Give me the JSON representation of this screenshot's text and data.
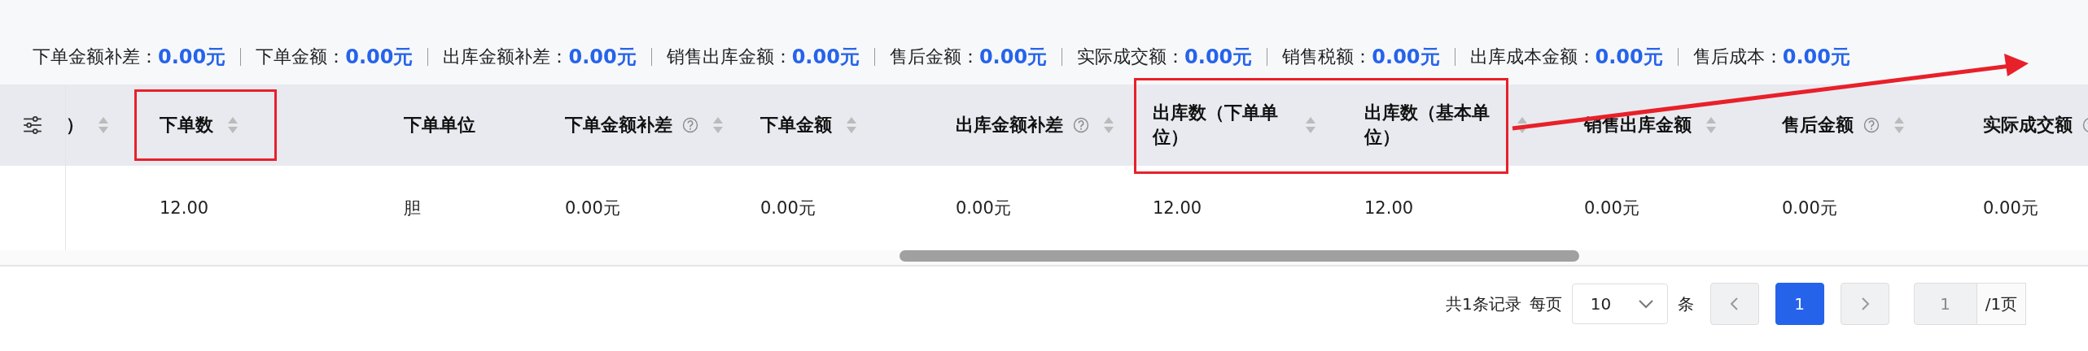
{
  "summary": [
    {
      "label": "下单金额补差：",
      "value": "0.00元"
    },
    {
      "label": "下单金额：",
      "value": "0.00元"
    },
    {
      "label": "出库金额补差：",
      "value": "0.00元"
    },
    {
      "label": "销售出库金额：",
      "value": "0.00元"
    },
    {
      "label": "售后金额：",
      "value": "0.00元"
    },
    {
      "label": "实际成交额：",
      "value": "0.00元"
    },
    {
      "label": "销售税额：",
      "value": "0.00元"
    },
    {
      "label": "出库成本金额：",
      "value": "0.00元"
    },
    {
      "label": "售后成本：",
      "value": "0.00元"
    }
  ],
  "table": {
    "columns": [
      {
        "title": "）",
        "sortable": true,
        "help": false
      },
      {
        "title": "下单数",
        "sortable": true,
        "help": false
      },
      {
        "title": "下单单位",
        "sortable": false,
        "help": false
      },
      {
        "title": "下单金额补差",
        "sortable": true,
        "help": true
      },
      {
        "title": "下单金额",
        "sortable": true,
        "help": false
      },
      {
        "title": "出库金额补差",
        "sortable": true,
        "help": true
      },
      {
        "title": "出库数（下单单位）",
        "sortable": true,
        "help": false
      },
      {
        "title": "出库数（基本单位）",
        "sortable": true,
        "help": false
      },
      {
        "title": "销售出库金额",
        "sortable": true,
        "help": false
      },
      {
        "title": "售后金额",
        "sortable": true,
        "help": true
      },
      {
        "title": "实际成交额",
        "sortable": false,
        "help": true
      }
    ],
    "rows": [
      {
        "cells": [
          null,
          "12.00",
          "胆",
          "0.00元",
          "0.00元",
          "0.00元",
          "12.00",
          "12.00",
          "0.00元",
          "0.00元",
          "0.00元"
        ]
      }
    ]
  },
  "pagination": {
    "total": "共1条记录",
    "per_page_label": "每页",
    "page_size": "10",
    "per_page_unit": "条",
    "pages": [
      {
        "label": "1",
        "selected": true
      }
    ],
    "jump_value": "1",
    "page_count": "/1页"
  }
}
